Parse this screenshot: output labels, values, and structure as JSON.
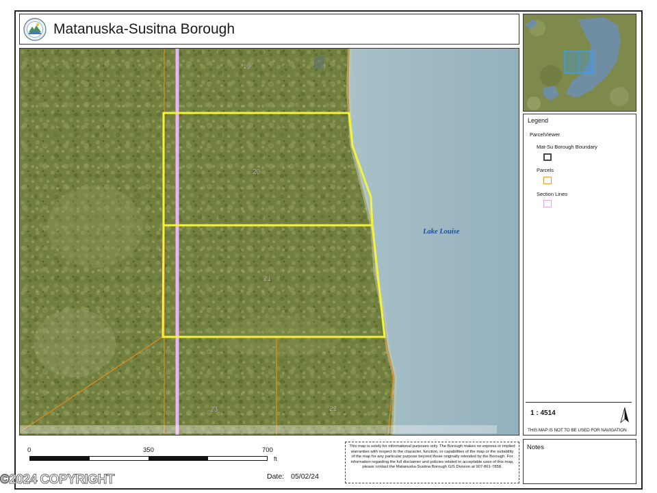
{
  "header": {
    "title": "Matanuska-Susitna Borough"
  },
  "map": {
    "lake_label": "Lake Louise",
    "parcel_labels": [
      "19",
      "20",
      "21",
      "22",
      "23"
    ],
    "colors": {
      "parcel_selected": "#f4f23a",
      "parcel_outline": "#e5891f",
      "section_line": "#e9b6ee",
      "water": "#9fb9c3",
      "land": "#6f7e3e"
    }
  },
  "overview": {
    "colors": {
      "highlight": "#3b9cf0"
    }
  },
  "legend": {
    "title": "Legend",
    "group": "ParcelViewer",
    "items": [
      {
        "label": "Mat-Su Borough Boundary",
        "swatch_color": "#444444"
      },
      {
        "label": "Parcels",
        "swatch_color": "#e89a2c"
      },
      {
        "label": "Section Lines",
        "swatch_color": "#e6a6ef"
      }
    ],
    "scale_ratio": "1 : 4514",
    "navigation_warning": "THIS MAP IS NOT TO BE USED FOR NAVIGATION",
    "north_arrow_icon": "north-arrow-icon"
  },
  "scalebar": {
    "ticks": [
      "0",
      "350",
      "700"
    ],
    "unit": "ft"
  },
  "date": {
    "label": "Date:",
    "value": "05/02/24"
  },
  "disclaimer": {
    "text": "This map is solely for informational purposes only. The Borough makes no express or implied warranties with respect to the character, function, or capabilities of the map or the suitability of the map for any particular purpose beyond those originally intended by the Borough. For information regarding the full disclaimer and policies related to acceptable uses of this map, please contact the Matanuska-Susitna Borough GIS Division at 907-861-7858."
  },
  "notes": {
    "title": "Notes"
  },
  "watermark": {
    "text": "©2024 COPYRIGHT"
  }
}
